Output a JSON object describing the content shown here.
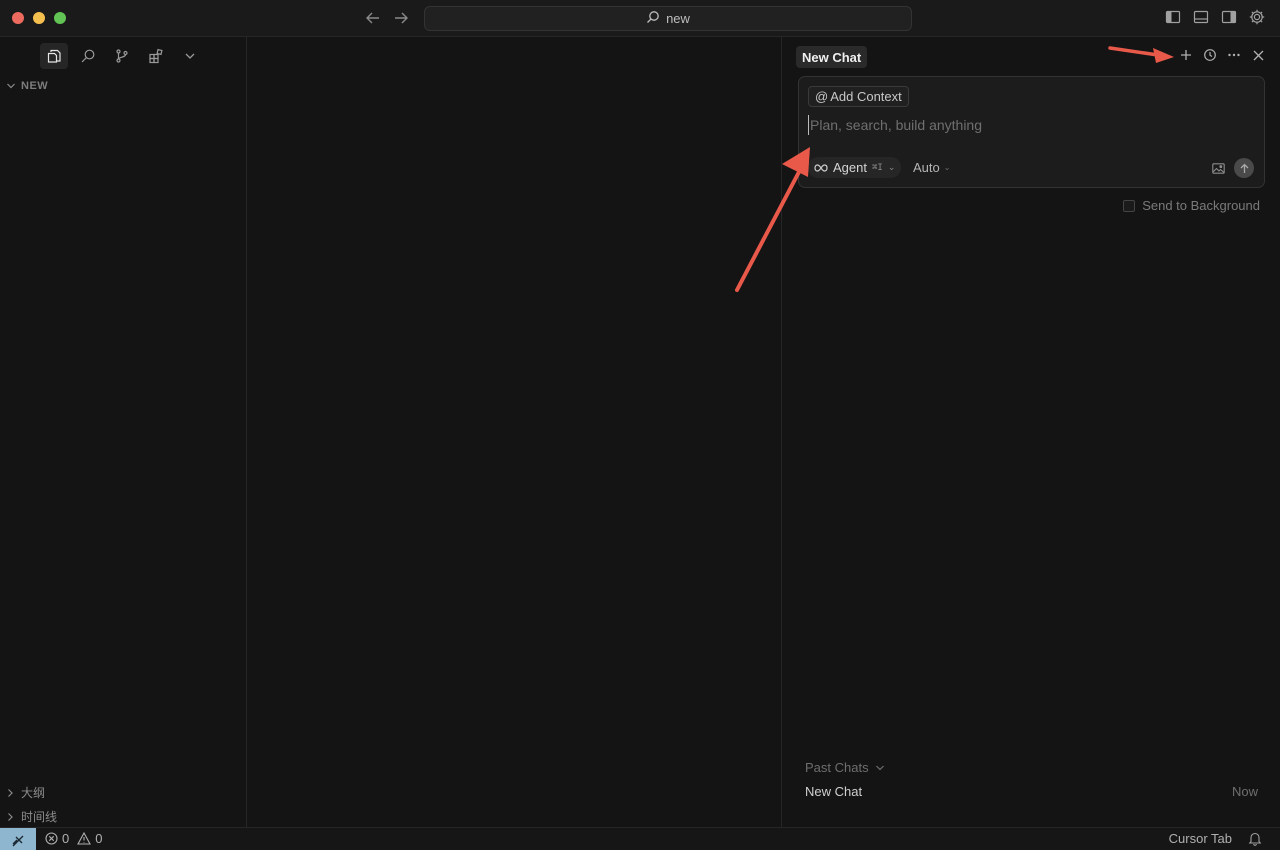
{
  "titlebar": {
    "search_text": "new",
    "icons": [
      "close-traffic-light",
      "minimize-traffic-light",
      "maximize-traffic-light",
      "back-arrow-icon",
      "forward-arrow-icon",
      "search-icon",
      "toggle-primary-sidebar-icon",
      "toggle-panel-icon",
      "toggle-secondary-sidebar-icon",
      "gear-icon"
    ]
  },
  "sidebar": {
    "activity_icons": [
      "files-icon",
      "search-icon",
      "source-control-icon",
      "extensions-icon",
      "chevron-down-icon"
    ],
    "folder_label": "NEW",
    "outline_label": "大纲",
    "timeline_label": "时间线"
  },
  "chat": {
    "tab_title": "New Chat",
    "action_icons": [
      "plus-icon",
      "history-icon",
      "more-icon",
      "close-icon"
    ],
    "add_context_at": "@",
    "add_context_label": "Add Context",
    "placeholder": "Plan, search, build anything",
    "mode_label": "Agent",
    "mode_shortcut": "⌘I",
    "model_label": "Auto",
    "send_to_background_label": "Send to Background",
    "past_chats_label": "Past Chats",
    "past_chats": [
      {
        "title": "New Chat",
        "time": "Now"
      }
    ]
  },
  "statusbar": {
    "errors": "0",
    "warnings": "0",
    "cursor_tab_label": "Cursor Tab"
  },
  "colors": {
    "annotation_arrow": "#e8594a",
    "remote_indicator": "#8fb6cf",
    "background": "#141414"
  }
}
